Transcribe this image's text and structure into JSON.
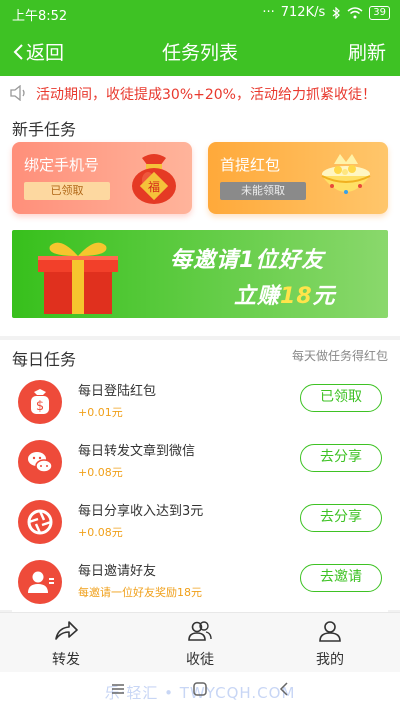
{
  "status_bar": {
    "time": "上午8:52",
    "dots": "···",
    "speed": "712K/s",
    "battery": "39"
  },
  "nav": {
    "back_label": "返回",
    "title": "任务列表",
    "refresh_label": "刷新"
  },
  "notice": {
    "text": "活动期间，收徒提成30%+20%，活动给力抓紧收徒！"
  },
  "newbie": {
    "title": "新手任务",
    "cards": [
      {
        "title": "绑定手机号",
        "badge": "已领取"
      },
      {
        "title": "首提红包",
        "badge": "未能领取"
      }
    ],
    "banner": {
      "line1": "每邀请1位好友",
      "line2_prefix": "立赚",
      "line2_highlight": "18",
      "line2_suffix": "元"
    }
  },
  "daily": {
    "title": "每日任务",
    "hint": "每天做任务得红包",
    "tasks": [
      {
        "name": "每日登陆红包",
        "reward": "+0.01元",
        "button": "已领取",
        "icon": "money-bag-icon"
      },
      {
        "name": "每日转发文章到微信",
        "reward": "+0.08元",
        "button": "去分享",
        "icon": "wechat-icon"
      },
      {
        "name": "每日分享收入达到3元",
        "reward": "+0.08元",
        "button": "去分享",
        "icon": "shutter-icon"
      },
      {
        "name": "每日邀请好友",
        "reward": "每邀请一位好友奖励18元",
        "button": "去邀请",
        "icon": "invite-user-icon"
      }
    ]
  },
  "tabbar": {
    "tabs": [
      {
        "label": "转发",
        "icon": "share-icon"
      },
      {
        "label": "收徒",
        "icon": "group-icon"
      },
      {
        "label": "我的",
        "icon": "user-icon"
      }
    ]
  },
  "watermark": "乐·轻汇 • TWYCQH.COM",
  "colors": {
    "brand_green": "#3ec224",
    "notice_red": "#e8392e",
    "reward_orange": "#f0a01b",
    "task_icon_red": "#ee4b3a"
  }
}
